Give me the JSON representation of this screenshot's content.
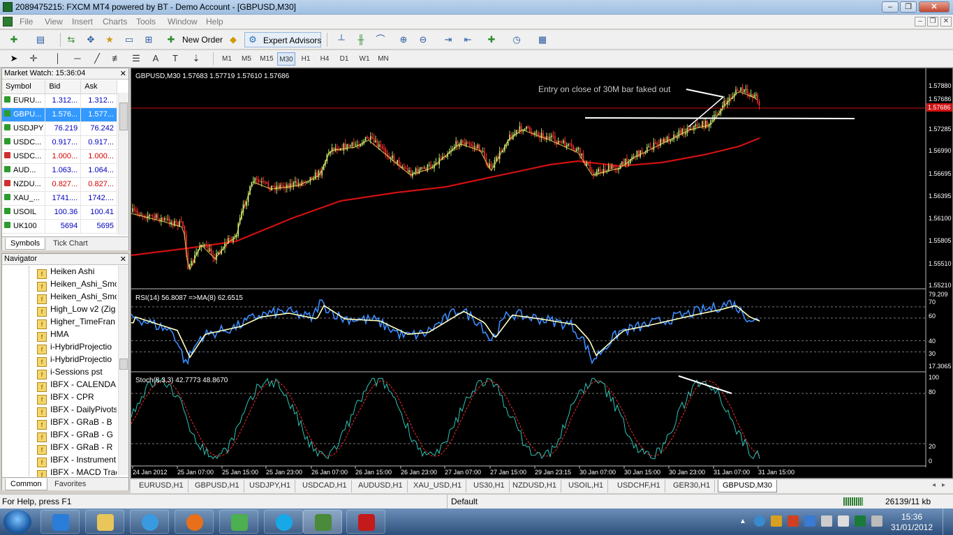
{
  "window": {
    "title": "2089475215: FXCM MT4 powered by BT - Demo Account - [GBPUSD,M30]"
  },
  "menu": [
    "File",
    "View",
    "Insert",
    "Charts",
    "Tools",
    "Window",
    "Help"
  ],
  "toolbar": {
    "new_order": "New Order",
    "expert_advisors": "Expert Advisors"
  },
  "timeframes": [
    "M1",
    "M5",
    "M15",
    "M30",
    "H1",
    "H4",
    "D1",
    "W1",
    "MN"
  ],
  "active_timeframe": "M30",
  "market_watch": {
    "title": "Market Watch: 15:36:04",
    "columns": [
      "Symbol",
      "Bid",
      "Ask"
    ],
    "rows": [
      {
        "symbol": "EURU...",
        "bid": "1.312...",
        "ask": "1.312...",
        "dir": "up"
      },
      {
        "symbol": "GBPU...",
        "bid": "1.576...",
        "ask": "1.577...",
        "dir": "up"
      },
      {
        "symbol": "USDJPY",
        "bid": "76.219",
        "ask": "76.242",
        "dir": "up"
      },
      {
        "symbol": "USDC...",
        "bid": "0.917...",
        "ask": "0.917...",
        "dir": "up"
      },
      {
        "symbol": "USDC...",
        "bid": "1.000...",
        "ask": "1.000...",
        "dir": "down"
      },
      {
        "symbol": "AUD...",
        "bid": "1.063...",
        "ask": "1.064...",
        "dir": "up"
      },
      {
        "symbol": "NZDU...",
        "bid": "0.827...",
        "ask": "0.827...",
        "dir": "down"
      },
      {
        "symbol": "XAU_...",
        "bid": "1741....",
        "ask": "1742....",
        "dir": "up"
      },
      {
        "symbol": "USOIL",
        "bid": "100.36",
        "ask": "100.41",
        "dir": "up"
      },
      {
        "symbol": "UK100",
        "bid": "5694",
        "ask": "5695",
        "dir": "up"
      }
    ],
    "tabs": [
      "Symbols",
      "Tick Chart"
    ]
  },
  "navigator": {
    "title": "Navigator",
    "items": [
      "Heiken Ashi",
      "Heiken_Ashi_Smo",
      "Heiken_Ashi_Smo",
      "High_Low v2 (Zig",
      "Higher_TimeFran",
      "HMA",
      "i-HybridProjectio",
      "i-HybridProjectio",
      "i-Sessions pst",
      "IBFX - CALENDAR",
      "IBFX - CPR",
      "IBFX - DailyPivots",
      "IBFX - GRaB - B",
      "IBFX - GRaB - G",
      "IBFX - GRaB - R",
      "IBFX - Instrument",
      "IBFX - MACD Trac"
    ],
    "tabs": [
      "Common",
      "Favorites"
    ]
  },
  "chart": {
    "header": "GBPUSD,M30  1.57683 1.57719 1.57610 1.57686",
    "annotation": "Entry on close of 30M bar faked out",
    "rsi_label": "RSI(14) 56.8087  =>MA(8) 62.6515",
    "stoch_label": "Stoch(8,3,3) 42.7773 48.8670",
    "current_price": "1.57686",
    "price_ticks": [
      "1.57880",
      "1.57686",
      "1.57285",
      "1.56990",
      "1.56695",
      "1.56395",
      "1.56100",
      "1.55805",
      "1.55510",
      "1.55210"
    ],
    "rsi_ticks": [
      "79.209",
      "70",
      "60",
      "40",
      "30",
      "17.3065"
    ],
    "stoch_ticks": [
      "100",
      "80",
      "20",
      "0"
    ],
    "time_ticks": [
      "24 Jan 2012",
      "25 Jan 07:00",
      "25 Jan 15:00",
      "25 Jan 23:00",
      "26 Jan 07:00",
      "26 Jan 15:00",
      "26 Jan 23:00",
      "27 Jan 07:00",
      "27 Jan 15:00",
      "29 Jan 23:15",
      "30 Jan 07:00",
      "30 Jan 15:00",
      "30 Jan 23:00",
      "31 Jan 07:00",
      "31 Jan 15:00"
    ],
    "colors": {
      "background": "#000000",
      "bull_candle": "#7ec8ff",
      "bear_candle": "#ff3030",
      "ma": "#d01010",
      "rsi": "#3a8cff",
      "rsi_ma": "#ffffc0",
      "stoch_main": "#2ec4b6",
      "stoch_signal": "#ff2a2a"
    }
  },
  "chart_tabs": [
    "EURUSD,H1",
    "GBPUSD,H1",
    "USDJPY,H1",
    "USDCAD,H1",
    "AUDUSD,H1",
    "XAU_USD,H1",
    "US30,H1",
    "NZDUSD,H1",
    "USOIL,H1",
    "USDCHF,H1",
    "GER30,H1",
    "GBPUSD,M30"
  ],
  "active_chart_tab": "GBPUSD,M30",
  "status": {
    "help": "For Help, press F1",
    "profile": "Default",
    "traffic": "26139/11 kb"
  },
  "taskbar": {
    "time": "15:36",
    "date": "31/01/2012"
  }
}
